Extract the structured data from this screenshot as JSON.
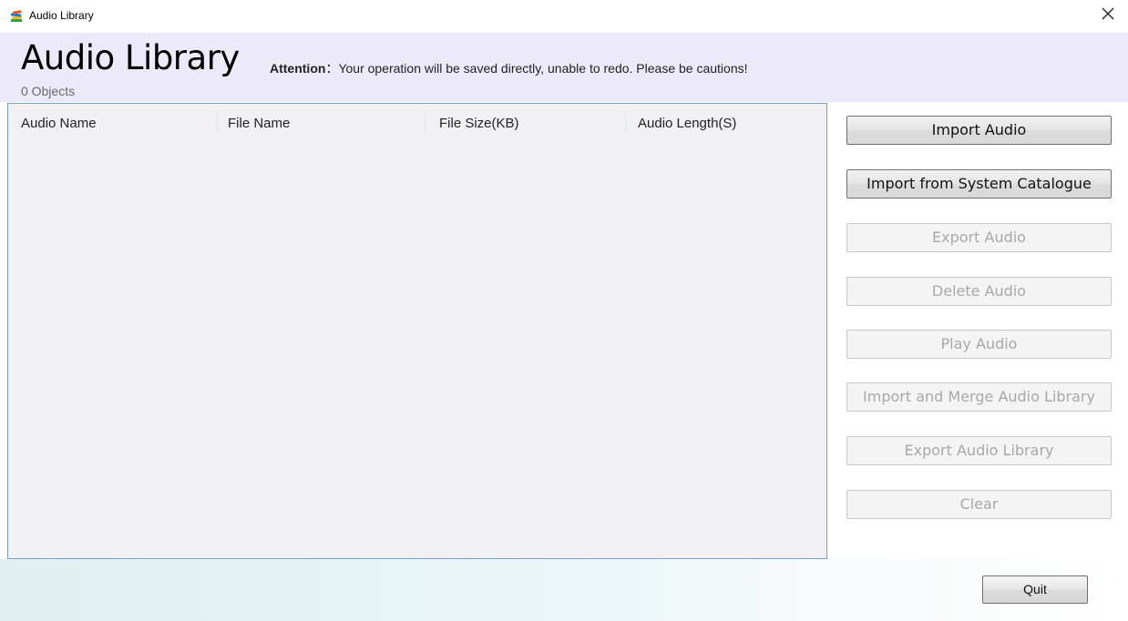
{
  "window": {
    "title": "Audio Library",
    "icon": "stacked-books-icon",
    "close_glyph": "✕"
  },
  "header": {
    "title": "Audio Library",
    "object_count": "0 Objects",
    "attention_label": "Attention",
    "attention_separator": "：",
    "attention_text": "Your operation will be saved directly, unable to redo. Please be cautions!"
  },
  "table": {
    "columns": [
      "Audio Name",
      "File Name",
      "File Size(KB)",
      "Audio Length(S)"
    ],
    "rows": []
  },
  "actions": [
    {
      "label": "Import Audio",
      "enabled": true
    },
    {
      "label": "Import from System Catalogue",
      "enabled": true
    },
    {
      "label": "Export Audio",
      "enabled": false
    },
    {
      "label": "Delete Audio",
      "enabled": false
    },
    {
      "label": "Play Audio",
      "enabled": false
    },
    {
      "label": "Import and Merge Audio Library",
      "enabled": false
    },
    {
      "label": "Export Audio Library",
      "enabled": false
    },
    {
      "label": "Clear",
      "enabled": false
    }
  ],
  "footer": {
    "quit_label": "Quit"
  },
  "colors": {
    "header_bg": "#eceaf8",
    "panel_border": "#7a9fc7",
    "panel_bg": "#f1f1f3",
    "disabled_text": "#a8a8a8"
  }
}
